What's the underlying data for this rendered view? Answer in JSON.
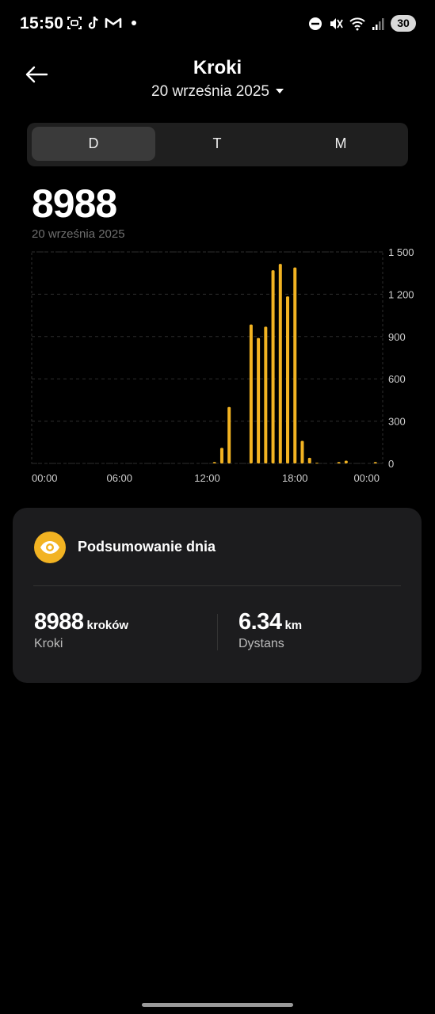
{
  "status_bar": {
    "time": "15:50",
    "battery": "30"
  },
  "header": {
    "title": "Kroki",
    "date": "20 września 2025"
  },
  "tabs": [
    {
      "label": "D"
    },
    {
      "label": "T"
    },
    {
      "label": "M"
    }
  ],
  "summary_top": {
    "value": "8988",
    "date": "20 września 2025"
  },
  "chart_data": {
    "type": "bar",
    "x_tick_labels": [
      "00:00",
      "06:00",
      "12:00",
      "18:00",
      "00:00"
    ],
    "y_tick_labels": [
      "1 500",
      "1 200",
      "900",
      "600",
      "300",
      "0"
    ],
    "ylim": [
      0,
      1500
    ],
    "grid": true,
    "color": "#f2b322",
    "hours": [
      12.5,
      13.0,
      13.5,
      15.0,
      15.5,
      16.0,
      16.5,
      17.0,
      17.5,
      18.0,
      18.5,
      19.0,
      19.5,
      21.0,
      21.5,
      23.5
    ],
    "values": [
      10,
      110,
      400,
      985,
      890,
      970,
      1370,
      1415,
      1185,
      1390,
      160,
      40,
      5,
      10,
      20,
      10
    ]
  },
  "summary_card": {
    "title": "Podsumowanie dnia",
    "steps": {
      "value": "8988",
      "unit": "kroków",
      "label": "Kroki"
    },
    "distance": {
      "value": "6.34",
      "unit": "km",
      "label": "Dystans"
    }
  }
}
